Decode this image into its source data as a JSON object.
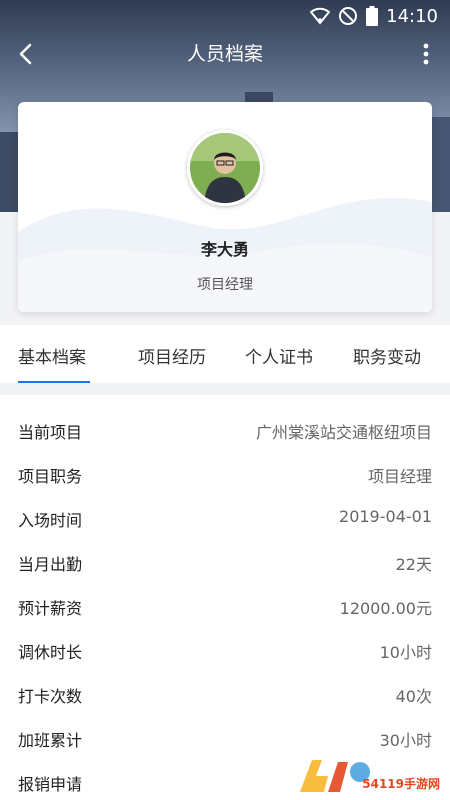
{
  "status": {
    "time": "14:10"
  },
  "nav": {
    "title": "人员档案"
  },
  "profile": {
    "name": "李大勇",
    "role": "项目经理"
  },
  "tabs": [
    {
      "label": "基本档案",
      "active": true
    },
    {
      "label": "项目经历",
      "active": false
    },
    {
      "label": "个人证书",
      "active": false
    },
    {
      "label": "职务变动",
      "active": false
    }
  ],
  "info": [
    {
      "label": "当前项目",
      "value": "广州棠溪站交通枢纽项目"
    },
    {
      "label": "项目职务",
      "value": "项目经理"
    },
    {
      "label": "入场时间",
      "value": "2019-04-01"
    },
    {
      "label": "当月出勤",
      "value": "22天"
    },
    {
      "label": "预计薪资",
      "value": "12000.00元"
    },
    {
      "label": "调休时长",
      "value": "10小时"
    },
    {
      "label": "打卡次数",
      "value": "40次"
    },
    {
      "label": "加班累计",
      "value": "30小时"
    },
    {
      "label": "报销申请",
      "value": ""
    }
  ],
  "watermark": {
    "text": "54119手游网"
  },
  "colors": {
    "accent": "#1a73e8"
  },
  "icons": {
    "back": "chevron-left-icon",
    "more": "more-vertical-icon",
    "wifi": "wifi-icon",
    "dnd": "do-not-disturb-icon",
    "battery": "battery-icon"
  }
}
